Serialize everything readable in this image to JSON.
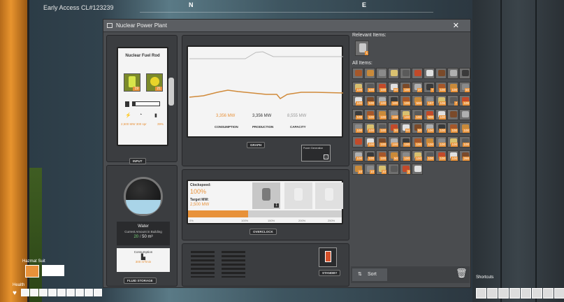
{
  "hud": {
    "build_label": "Early Access CL#123239",
    "compass": {
      "n": "N",
      "e": "E"
    },
    "hazmat_label": "Hazmat Suit",
    "health_label": "Health",
    "shortcuts_label": "Shortcuts",
    "shortcut_keys": [
      "1",
      "2",
      "3",
      "4",
      "5",
      "6",
      "7",
      "8",
      "9",
      "10"
    ]
  },
  "window": {
    "title": "Nuclear Power Plant",
    "close": "✕",
    "input_panel": {
      "title": "Nuclear Fuel Rod",
      "slot_a_count": "19",
      "slot_b_count": "21",
      "stat_rate": "2,500 MW 300 spr",
      "stat_pct": "39%",
      "label": "INPUT"
    },
    "graph_panel": {
      "consumption_value": "3,356 MW",
      "consumption_label": "CONSUMPTION",
      "production_value": "3,356 MW",
      "production_label": "PRODUCTION",
      "capacity_value": "8,555 MW",
      "capacity_label": "CAPACITY",
      "label": "GRAPH",
      "note_title": "Power Generation",
      "note_count": "1"
    },
    "fluid_panel": {
      "fluid_name": "Water",
      "current_label": "Current Amount in Building",
      "current_value": "20",
      "max_value": "50 m³",
      "consumption_label": "Consumption",
      "consumption_value": "300 m³/min",
      "label": "FLUID STORAGE"
    },
    "overclock_panel": {
      "clockspeed_label": "Clockspeed:",
      "clockspeed_value": "100%",
      "target_label": "Target MW:",
      "target_value": "2,500 MW",
      "tick_0": "0%",
      "tick_100": "100%",
      "tick_150": "150%",
      "tick_200": "200%",
      "tick_250": "250%",
      "shard_count": "1",
      "label": "OVERCLOCK"
    },
    "standby_label": "STANDBY",
    "relevant_items_label": "Relevant Items:",
    "relevant_item_count": "1",
    "all_items_label": "All Items:",
    "sort_label": "Sort",
    "colors": {
      "accent": "#e8923a",
      "panel": "#3b3d40",
      "frame": "#4a4c4f"
    }
  },
  "inventory": [
    [
      "",
      "",
      "",
      "",
      "",
      "",
      "",
      "",
      "",
      ""
    ],
    [
      "100",
      "100",
      "100",
      "50",
      "100",
      "37",
      "7",
      "100",
      "100",
      "50"
    ],
    [
      "100",
      "100",
      "100",
      "100",
      "100",
      "500",
      "187",
      "106",
      "7",
      "100"
    ],
    [
      "100",
      "100",
      "100",
      "100",
      "100",
      "100",
      "500",
      "100",
      "",
      ""
    ],
    [
      "100",
      "100",
      "100",
      "34",
      "94",
      "50",
      "100",
      "100",
      "100",
      "100"
    ],
    [
      "",
      "100",
      "100",
      "100",
      "100",
      "100",
      "100",
      "100",
      "100",
      "100"
    ],
    [
      "100",
      "100",
      "100",
      "50",
      "100",
      "100",
      "100",
      "100",
      "100",
      "266"
    ],
    [
      "10",
      "10",
      "10",
      "",
      "3",
      "",
      "",
      "",
      "",
      ""
    ]
  ]
}
